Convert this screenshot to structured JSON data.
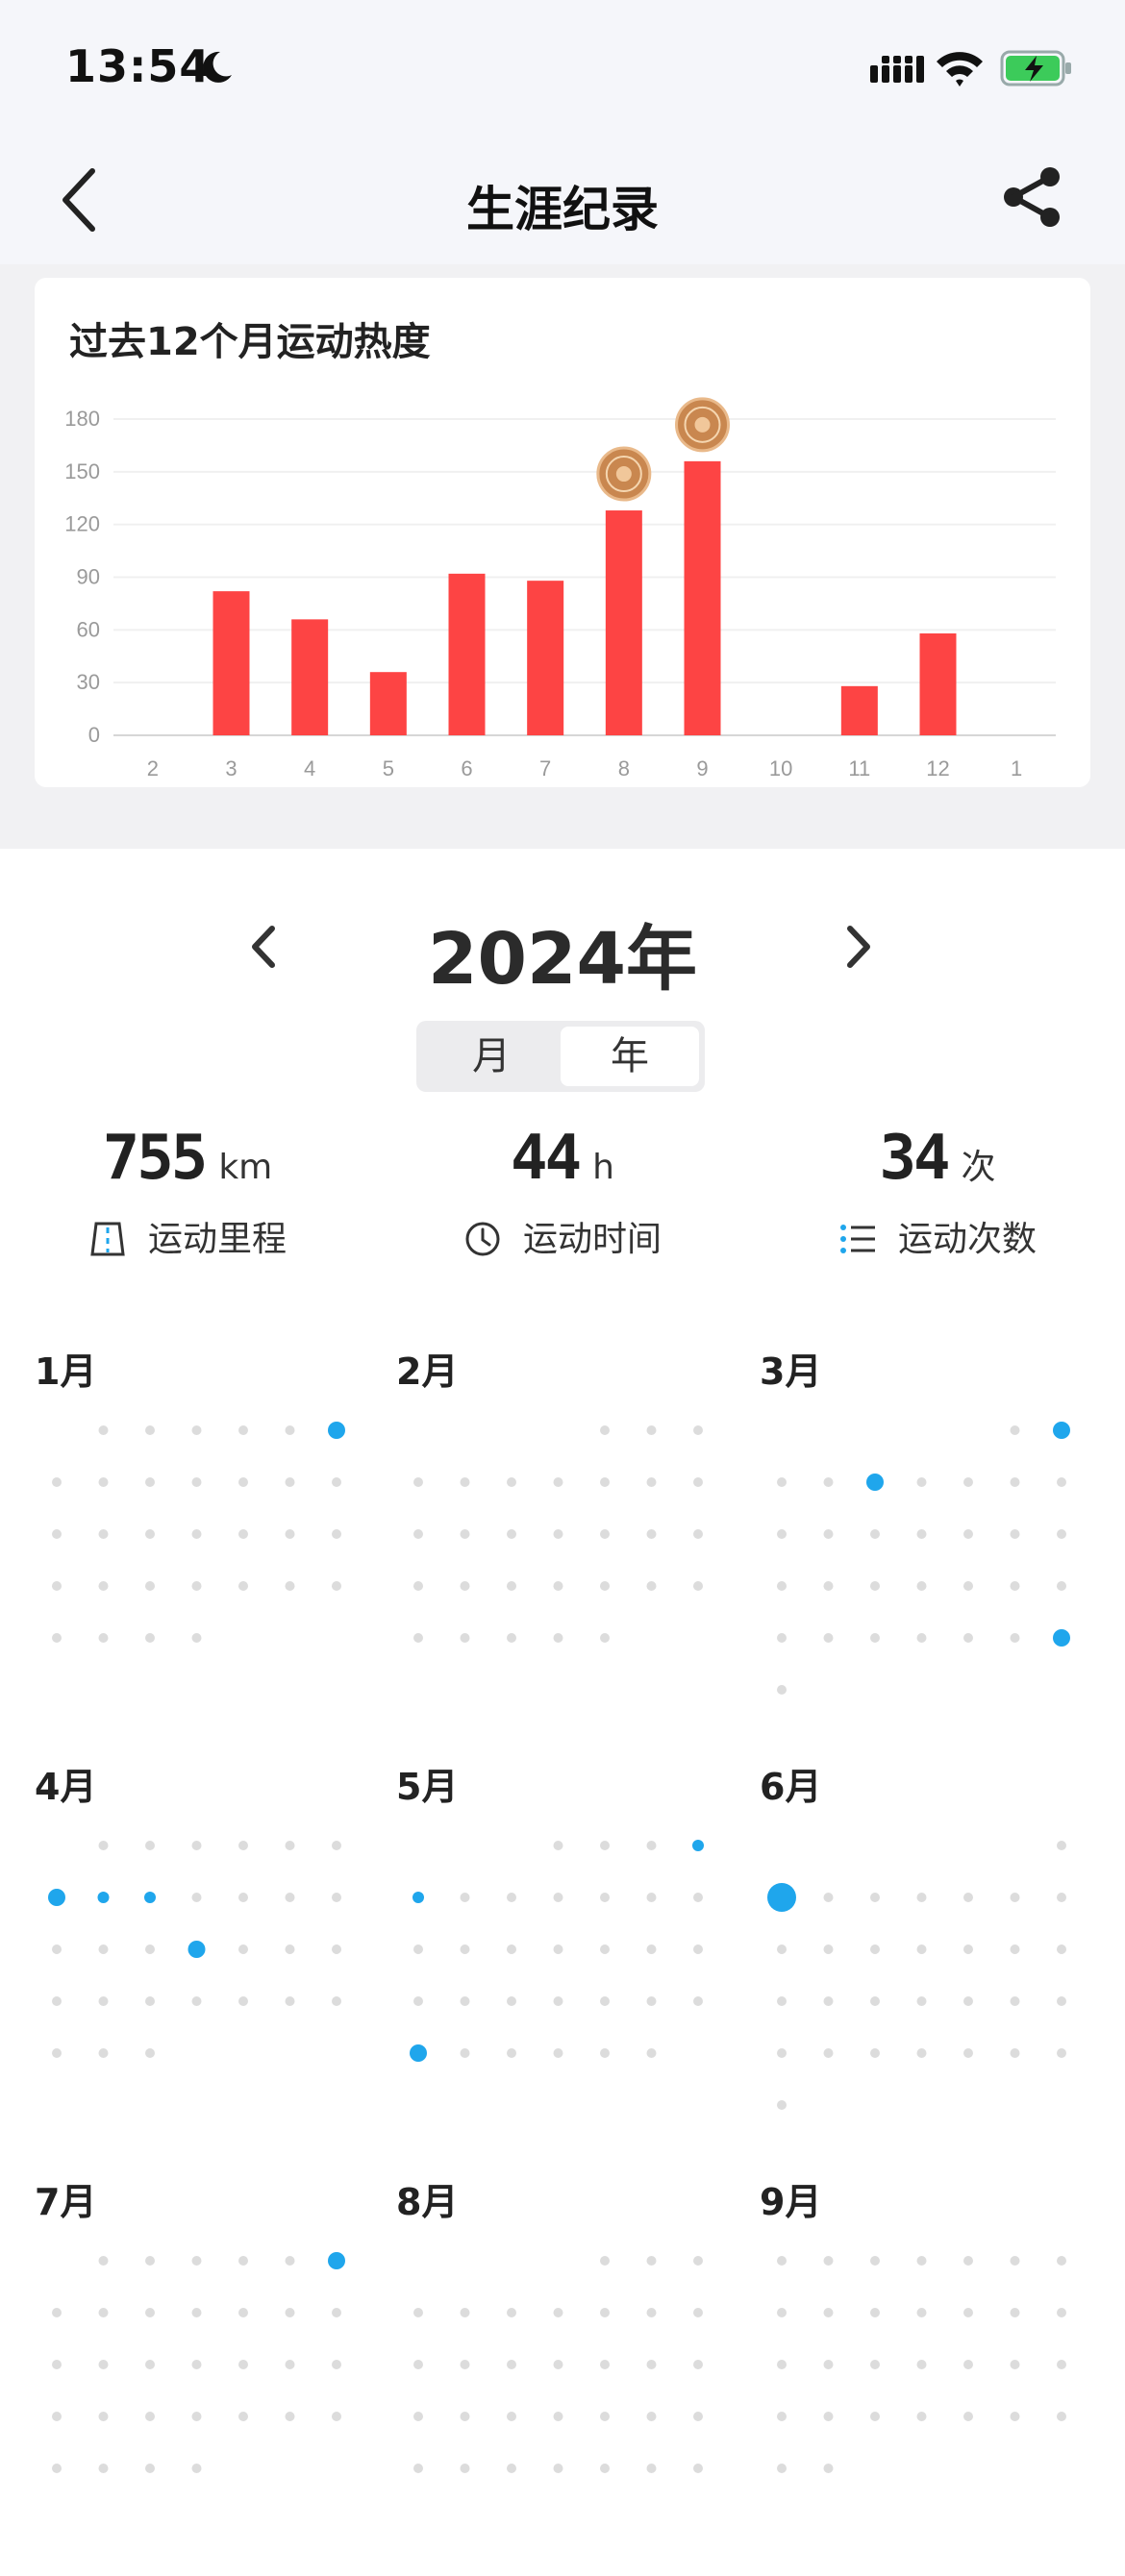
{
  "status_bar": {
    "time": "13:54"
  },
  "header": {
    "title": "生涯纪录"
  },
  "chart_data": {
    "type": "bar",
    "title": "过去12个月运动热度",
    "categories": [
      "2",
      "3",
      "4",
      "5",
      "6",
      "7",
      "8",
      "9",
      "10",
      "11",
      "12",
      "1"
    ],
    "values": [
      0,
      82,
      66,
      36,
      92,
      88,
      128,
      156,
      0,
      28,
      58,
      0
    ],
    "yticks": [
      0,
      30,
      60,
      90,
      120,
      150,
      180
    ],
    "ylim": [
      0,
      180
    ],
    "bar_color": "#fd4444",
    "medals_on": [
      "8",
      "9"
    ]
  },
  "year_selector": {
    "year": "2024年"
  },
  "toggle": {
    "month_label": "月",
    "year_label": "年",
    "selected": "年"
  },
  "stats": [
    {
      "value": "755",
      "unit": "km",
      "label": "运动里程",
      "icon": "road-icon"
    },
    {
      "value": "44",
      "unit": "h",
      "label": "运动时间",
      "icon": "clock-icon"
    },
    {
      "value": "34",
      "unit": "次",
      "label": "运动次数",
      "icon": "list-icon"
    }
  ],
  "calendar": {
    "dot_color": "#dcdcdc",
    "active_color": "#1fa6ec",
    "months": [
      {
        "label": "1月",
        "start": 1,
        "days": 31,
        "active": {
          "6": 2
        }
      },
      {
        "label": "2月",
        "start": 4,
        "days": 29,
        "active": {}
      },
      {
        "label": "3月",
        "start": 5,
        "days": 31,
        "active": {
          "2": 2,
          "5": 2,
          "30": 2
        }
      },
      {
        "label": "4月",
        "start": 1,
        "days": 30,
        "active": {
          "7": 2,
          "8": 1,
          "9": 1,
          "17": 2
        }
      },
      {
        "label": "5月",
        "start": 3,
        "days": 31,
        "active": {
          "4": 1,
          "5": 1,
          "26": 2
        }
      },
      {
        "label": "6月",
        "start": 6,
        "days": 30,
        "active": {
          "2": 3
        }
      },
      {
        "label": "7月",
        "start": 1,
        "days": 31,
        "active": {
          "6": 2
        }
      },
      {
        "label": "8月",
        "start": 4,
        "days": 31,
        "active": {}
      },
      {
        "label": "9月",
        "start": 0,
        "days": 30,
        "active": {}
      }
    ]
  }
}
